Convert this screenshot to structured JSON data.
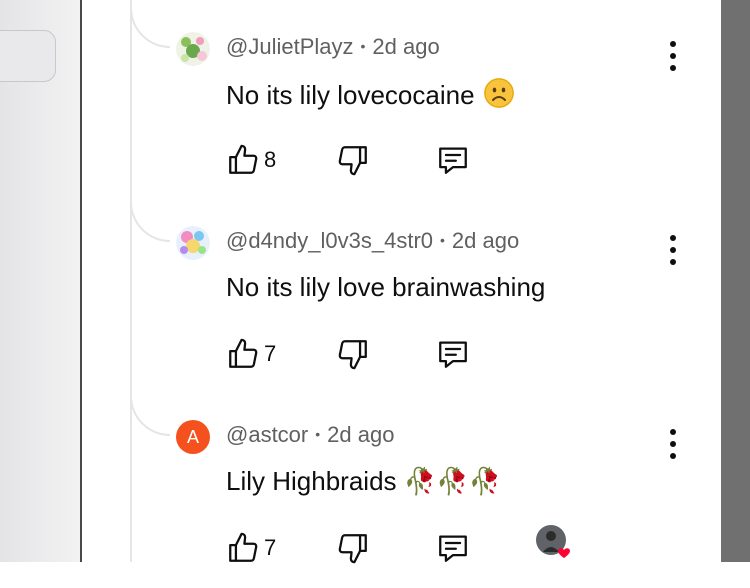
{
  "comments": [
    {
      "author": "@JulietPlayz",
      "time": "2d ago",
      "text": "No its lily lovecocaine",
      "emoji": "sad-face",
      "likes": "8",
      "avatar_type": "image"
    },
    {
      "author": "@d4ndy_l0v3s_4str0",
      "time": "2d ago",
      "text": "No its lily love brainwashing",
      "likes": "7",
      "avatar_type": "image"
    },
    {
      "author": "@astcor",
      "time": "2d ago",
      "text": "Lily Highbraids",
      "emoji": "🥀🥀🥀",
      "likes": "7",
      "avatar_letter": "A",
      "avatar_color": "#f4511e",
      "creator_heart": true
    }
  ],
  "separator": "•",
  "icons": {
    "like": "thumbs-up-icon",
    "dislike": "thumbs-down-icon",
    "reply": "reply-comment-icon",
    "more": "more-vertical-icon"
  },
  "colors": {
    "heart": "#ff0033",
    "meta": "#606060",
    "thread": "#e5e5e5"
  }
}
